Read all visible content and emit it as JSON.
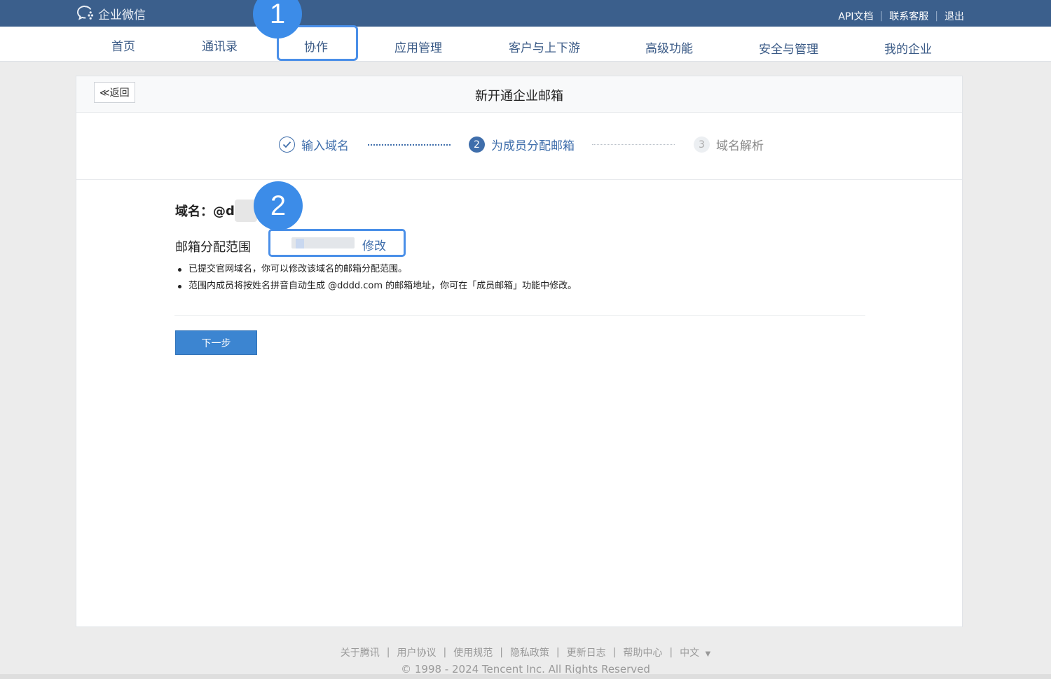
{
  "header": {
    "logo_text": "企业微信",
    "links": [
      "API文档",
      "联系客服",
      "退出"
    ]
  },
  "nav": {
    "items": [
      "首页",
      "通讯录",
      "协作",
      "应用管理",
      "客户与上下游",
      "高级功能",
      "安全与管理",
      "我的企业"
    ],
    "active": "协作"
  },
  "page": {
    "back_label": "≪返回",
    "title": "新开通企业邮箱"
  },
  "steps": [
    {
      "num": "✓",
      "label": "输入域名",
      "state": "done"
    },
    {
      "num": "2",
      "label": "为成员分配邮箱",
      "state": "active"
    },
    {
      "num": "3",
      "label": "域名解析",
      "state": "pending"
    }
  ],
  "form": {
    "domain_label": "域名：@",
    "domain_value": "d",
    "scope_label": "邮箱分配范围",
    "scope_edit": "修改",
    "notes": [
      "已提交官网域名，你可以修改该域名的邮箱分配范围。",
      "范围内成员将按姓名拼音自动生成 @dddd.com 的邮箱地址，你可在「成员邮箱」功能中修改。"
    ],
    "next_label": "下一步"
  },
  "annotations": {
    "badge1": "1",
    "badge2": "2",
    "highlight_color": "#4a8fe8"
  },
  "footer": {
    "links": [
      "关于腾讯",
      "用户协议",
      "使用规范",
      "隐私政策",
      "更新日志",
      "帮助中心"
    ],
    "language": "中文",
    "language_caret": "▼",
    "copyright": "© 1998 - 2024 Tencent Inc. All Rights Reserved"
  },
  "colors": {
    "topbar": "#3b5f8c",
    "accent": "#3f6eab",
    "button": "#3c85d1"
  }
}
